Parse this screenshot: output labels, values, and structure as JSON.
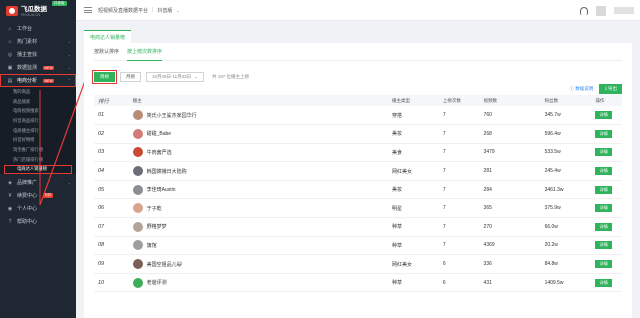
{
  "brand": {
    "name": "飞瓜数据",
    "sub": "FEIGUA.CN",
    "badge": "抖音版"
  },
  "sidebar": {
    "items": [
      {
        "label": "工作台",
        "icon": "home-icon",
        "arrow": ""
      },
      {
        "label": "热门素材",
        "icon": "fire-icon",
        "arrow": "⌄"
      },
      {
        "label": "播主查找",
        "icon": "user-search-icon",
        "arrow": "⌄"
      },
      {
        "label": "数据监测",
        "icon": "monitor-icon",
        "arrow": "⌄",
        "badge": "NEW"
      },
      {
        "label": "电商分析",
        "icon": "cart-icon",
        "arrow": "⌃",
        "badge": "NEW"
      }
    ],
    "sub_items": [
      "我的商品",
      "商品搜索",
      "电商视频搜索",
      "抖音商品排行",
      "电商播主排行",
      "抖音好物榜",
      "淘宝推广排行榜",
      "热门店铺排行榜",
      "电商达人销量榜"
    ],
    "bottom_items": [
      {
        "label": "品牌推广",
        "icon": "megaphone-icon",
        "arrow": "⌄"
      },
      {
        "label": "续费中心",
        "icon": "cash-icon",
        "arrow": "",
        "badge": "折扣"
      },
      {
        "label": "个人中心",
        "icon": "person-icon",
        "arrow": ""
      },
      {
        "label": "帮助中心",
        "icon": "help-icon",
        "arrow": ""
      }
    ]
  },
  "topbar": {
    "platform": "短视频及直播数据平台",
    "version": "抖音版"
  },
  "page_tab": "电商达人销量榜",
  "subtabs": [
    "按默认排序",
    "按上榜次数排序"
  ],
  "filters": {
    "day": "周榜",
    "month": "月榜",
    "date": "10月28日-11月03日",
    "total": "共 197 位播主上榜"
  },
  "actions": {
    "help": "数据说明",
    "export": "导出"
  },
  "table": {
    "headers": [
      "排行",
      "播主",
      "播主类型",
      "上榜次数",
      "视频数",
      "粉丝数",
      "操作"
    ],
    "detail_label": "详情",
    "rows": [
      {
        "rank": "01",
        "name": "简氏小王鲨杰家园华行",
        "type": "穿搭",
        "times": "7",
        "videos": "760",
        "fans": "345.7w",
        "color": "#b98c76"
      },
      {
        "rank": "02",
        "name": "甜甜_Babe",
        "type": "美妆",
        "times": "7",
        "videos": "268",
        "fans": "596.4w",
        "color": "#d47a7a"
      },
      {
        "rank": "03",
        "name": "牛肉酱严选",
        "type": "美食",
        "times": "7",
        "videos": "3479",
        "fans": "533.5w",
        "color": "#c94a35"
      },
      {
        "rank": "04",
        "name": "韩国嫦娥日大陆购",
        "type": "网红美女",
        "times": "7",
        "videos": "281",
        "fans": "245.4w",
        "color": "#6c6f78"
      },
      {
        "rank": "05",
        "name": "李佳琦Austin",
        "type": "美妆",
        "times": "7",
        "videos": "284",
        "fans": "3461.3w",
        "color": "#8a8d94"
      },
      {
        "rank": "06",
        "name": "于子乾",
        "type": "明星",
        "times": "7",
        "videos": "365",
        "fans": "375.9w",
        "color": "#d9a48c"
      },
      {
        "rank": "07",
        "name": "野格梦梦",
        "type": "种草",
        "times": "7",
        "videos": "270",
        "fans": "66.0w",
        "color": "#b3a49a"
      },
      {
        "rank": "08",
        "name": "旗馆",
        "type": "种草",
        "times": "7",
        "videos": "4369",
        "fans": "20.2w",
        "color": "#9e9e9e"
      },
      {
        "rank": "09",
        "name": "美国空姐品儿😺",
        "type": "网红美女",
        "times": "6",
        "videos": "336",
        "fans": "84.8w",
        "color": "#7d5f5a"
      },
      {
        "rank": "10",
        "name": "老爸评测",
        "type": "种草",
        "times": "6",
        "videos": "431",
        "fans": "1409.5w",
        "color": "#3fae5a"
      }
    ]
  },
  "colors": {
    "accent": "#2fb35c",
    "sidebar": "#1f2733",
    "highlight": "#e53935"
  }
}
